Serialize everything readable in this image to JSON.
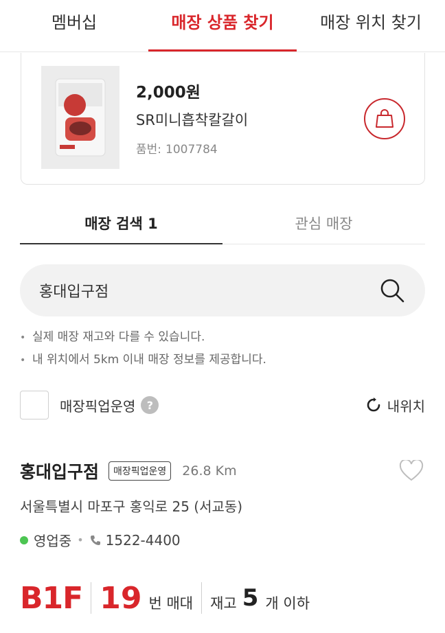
{
  "top_tabs": [
    {
      "label": "멤버십",
      "active": false
    },
    {
      "label": "매장 상품 찾기",
      "active": true
    },
    {
      "label": "매장 위치 찾기",
      "active": false
    }
  ],
  "product": {
    "price": "2,000원",
    "name": "SR미니흡착칼갈이",
    "code_label": "품번:",
    "code": "1007784"
  },
  "search_tabs": [
    {
      "label": "매장 검색 1",
      "active": true
    },
    {
      "label": "관심 매장",
      "active": false
    }
  ],
  "search": {
    "value": "홍대입구점"
  },
  "notes": [
    "실제 매장 재고와 다를 수 있습니다.",
    "내 위치에서 5km 이내 매장 정보를 제공합니다."
  ],
  "filter": {
    "pickup_label": "매장픽업운영",
    "help": "?",
    "my_location_label": "내위치"
  },
  "store": {
    "name": "홍대입구점",
    "badge": "매장픽업운영",
    "distance": "26.8 Km",
    "address": "서울특별시 마포구 홍익로 25 (서교동)",
    "status": "영업중",
    "phone": "1522-4400",
    "floor": "B1F",
    "shelf_number": "19",
    "shelf_unit": "번 매대",
    "stock_label": "재고",
    "stock_number": "5",
    "stock_unit": "개 이하"
  },
  "colors": {
    "accent": "#d9262b",
    "status_open": "#4cc552"
  }
}
